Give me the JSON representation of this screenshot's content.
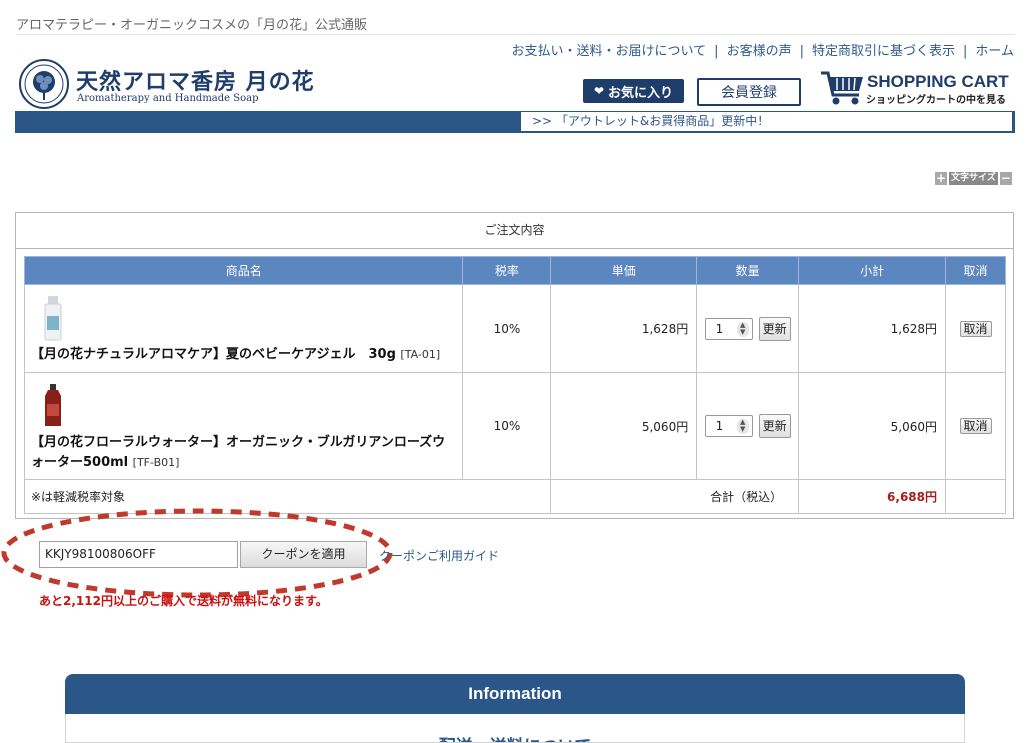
{
  "header": {
    "tagline": "アロマテラピー・オーガニックコスメの「月の花」公式通販",
    "links": [
      "お支払い・送料・お届けについて",
      "お客様の声",
      "特定商取引に基づく表示",
      "ホーム"
    ],
    "separator": "|",
    "brand_jp": "天然アロマ香房 月の花",
    "brand_en": "Aromatherapy and Handmade Soap",
    "favorite_label": "お気に入り",
    "member_label": "会員登録",
    "cart_title": "SHOPPING CART",
    "cart_sub": "ショッピングカートの中を見る",
    "news": ">> 「アウトレット&お買得商品」更新中！"
  },
  "fontsize": {
    "plus": "+",
    "label": "文字サイズ",
    "minus": "−"
  },
  "order": {
    "title": "ご注文内容",
    "columns": [
      "商品名",
      "税率",
      "単価",
      "数量",
      "小計",
      "取消"
    ],
    "items": [
      {
        "name": "【月の花ナチュラルアロマケア】夏のベビーケアジェル　30g",
        "code": "[TA-01]",
        "tax": "10%",
        "price": "1,628円",
        "qty": "1",
        "update": "更新",
        "subtotal": "1,628円",
        "cancel": "取消"
      },
      {
        "name": "【月の花フローラルウォーター】オーガニック・ブルガリアンローズウォーター500ml",
        "code": "[TF-B01]",
        "tax": "10%",
        "price": "5,060円",
        "qty": "1",
        "update": "更新",
        "subtotal": "5,060円",
        "cancel": "取消"
      }
    ],
    "note": "※は軽減税率対象",
    "total_label": "合計（税込）",
    "total_value": "6,688円"
  },
  "coupon": {
    "code": "KKJY98100806OFF",
    "apply_label": "クーポンを適用",
    "guide_label": "クーポンご利用ガイド",
    "shipping_msg": "あと2,112円以上のご購入で送料が無料になります。"
  },
  "info": {
    "title": "Information",
    "subtitle": "配送・送料について"
  },
  "colors": {
    "navy": "#2b5688",
    "header_blue": "#5b86bf",
    "total_red": "#a61d1d",
    "annot_red": "#c0392b"
  }
}
